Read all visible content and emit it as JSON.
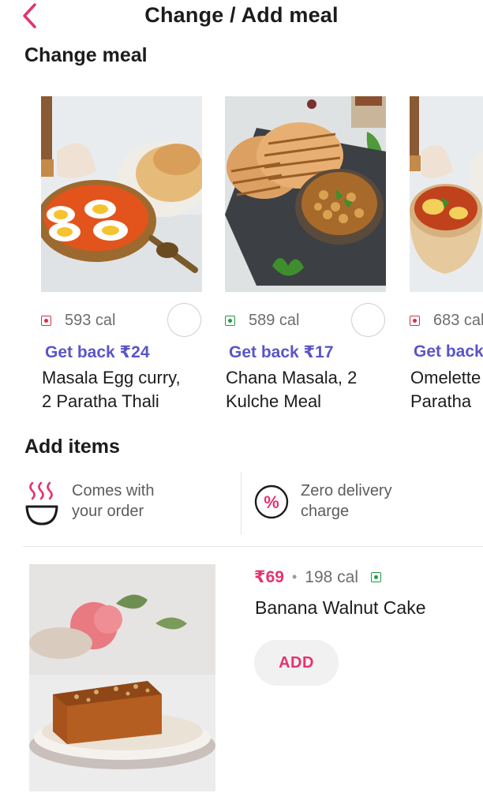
{
  "header": {
    "title": "Change / Add meal"
  },
  "colors": {
    "accent": "#e5336d",
    "cashback": "#5a55c6",
    "veg": "#1f9b45",
    "nonveg": "#d6304a"
  },
  "change_section": {
    "title": "Change meal",
    "meals": [
      {
        "cal": "593 cal",
        "type": "nonveg",
        "cashback": "Get back ₹24",
        "name_line1": "Masala Egg curry,",
        "name_line2": "2 Paratha Thali",
        "selected": false
      },
      {
        "cal": "589 cal",
        "type": "veg",
        "cashback": "Get back ₹17",
        "name_line1": "Chana Masala, 2",
        "name_line2": "Kulche Meal",
        "selected": false
      },
      {
        "cal": "683 cal",
        "type": "nonveg",
        "cashback": "Get back",
        "name_line1": "Omelette",
        "name_line2": "Paratha"
      }
    ]
  },
  "add_section": {
    "title": "Add items",
    "info": [
      {
        "icon": "steaming-bowl-icon",
        "line1": "Comes with",
        "line2": "your order"
      },
      {
        "icon": "discount-percent-icon",
        "line1": "Zero delivery",
        "line2": "charge"
      }
    ],
    "items": [
      {
        "price": "₹69",
        "separator": "•",
        "cal": "198 cal",
        "type": "veg",
        "name": "Banana Walnut Cake",
        "add_label": "ADD"
      }
    ]
  }
}
